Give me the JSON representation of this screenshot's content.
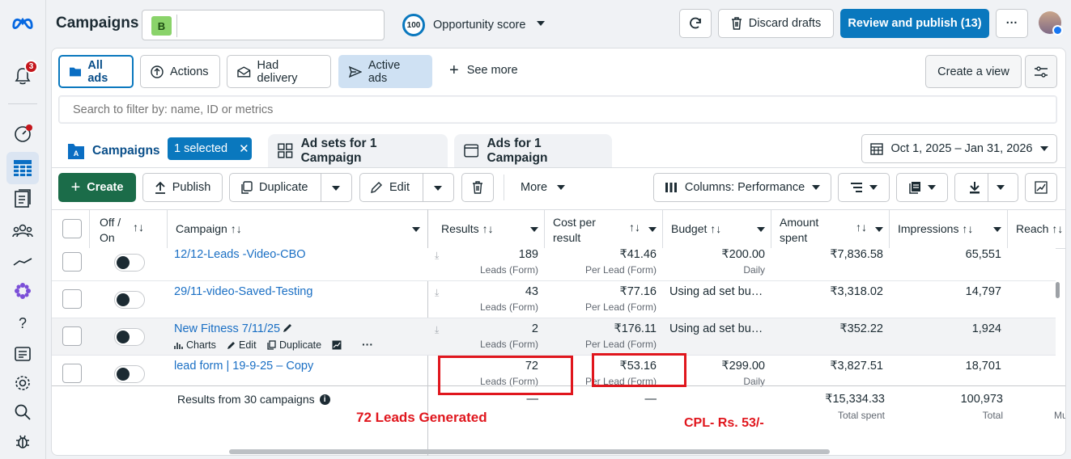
{
  "rail": {
    "notif_count": "3"
  },
  "topbar": {
    "title": "Campaigns",
    "account_initial": "B",
    "opp_score": "100",
    "opp_label": "Opportunity score",
    "discard": "Discard drafts",
    "review": "Review and publish (13)",
    "more": "···"
  },
  "filters": {
    "all_ads": "All ads",
    "actions": "Actions",
    "had_delivery": "Had delivery",
    "active_ads": "Active ads",
    "see_more": "See more",
    "create_view": "Create a view"
  },
  "search": {
    "placeholder": "Search to filter by: name, ID or metrics"
  },
  "tabs": {
    "campaigns": "Campaigns",
    "selected": "1 selected",
    "adsets": "Ad sets for 1 Campaign",
    "ads": "Ads for 1 Campaign"
  },
  "date_range": "Oct 1, 2025 – Jan 31, 2026",
  "toolbar": {
    "create": "Create",
    "publish": "Publish",
    "duplicate": "Duplicate",
    "edit": "Edit",
    "more": "More",
    "columns": "Columns: Performance"
  },
  "headers": {
    "off_on_1": "Off /",
    "off_on_2": "On",
    "campaign": "Campaign ↑↓",
    "results": "Results ↑↓",
    "cpr_1": "Cost per",
    "cpr_2": "result",
    "budget": "Budget ↑↓",
    "amount_1": "Amount",
    "amount_2": "spent",
    "impressions": "Impressions ↑↓",
    "reach": "Reach ↑↓"
  },
  "rows": [
    {
      "name": "12/12-Leads -Video-CBO",
      "results": "189",
      "results_sub": "Leads (Form)",
      "cpr": "₹41.46",
      "cpr_sub": "Per Lead (Form)",
      "budget": "₹200.00",
      "budget_sub": "Daily",
      "spent": "₹7,836.58",
      "impressions": "65,551"
    },
    {
      "name": "29/11-video-Saved-Testing",
      "results": "43",
      "results_sub": "Leads (Form)",
      "cpr": "₹77.16",
      "cpr_sub": "Per Lead (Form)",
      "budget": "Using ad set bu…",
      "budget_sub": "",
      "spent": "₹3,318.02",
      "impressions": "14,797"
    },
    {
      "name": "New Fitness 7/11/25",
      "results": "2",
      "results_sub": "Leads (Form)",
      "cpr": "₹176.11",
      "cpr_sub": "Per Lead (Form)",
      "budget": "Using ad set bu…",
      "budget_sub": "",
      "spent": "₹352.22",
      "impressions": "1,924"
    },
    {
      "name": "lead form | 19-9-25 – Copy",
      "results": "72",
      "results_sub": "Leads (Form)",
      "cpr": "₹53.16",
      "cpr_sub": "Per Lead (Form)",
      "budget": "₹299.00",
      "budget_sub": "Daily",
      "spent": "₹3,827.51",
      "impressions": "18,701"
    }
  ],
  "row_actions": {
    "charts": "Charts",
    "edit": "Edit",
    "duplicate": "Duplicate",
    "more": "···"
  },
  "totals": {
    "label": "Results from 30 campaigns",
    "results": "—",
    "cpr": "—",
    "spent": "₹15,334.33",
    "spent_sub": "Total spent",
    "impressions": "100,973",
    "impressions_sub": "Total",
    "reach_sub": "Mu"
  },
  "annotations": {
    "leads": "72 Leads Generated",
    "cpl": "CPL- Rs. 53/-"
  },
  "colors": {
    "primary": "#0a78be",
    "create_green": "#1b6c49",
    "annotation_red": "#e0161d",
    "link": "#1a6fc4"
  }
}
